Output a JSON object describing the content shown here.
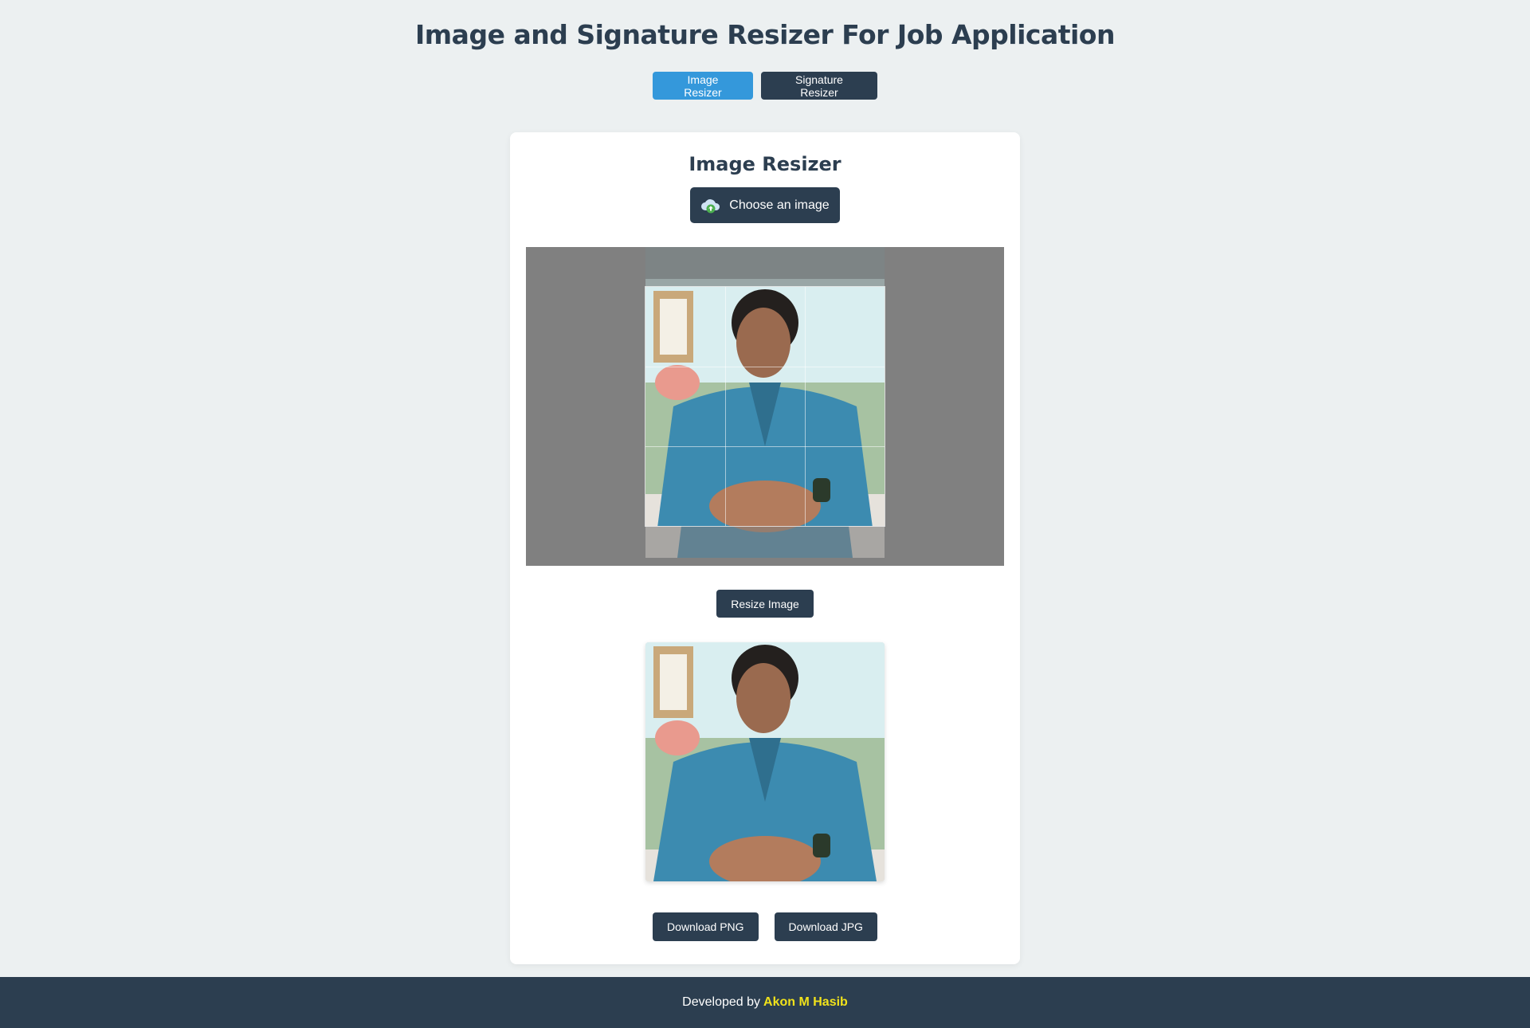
{
  "app": {
    "title": "Image and Signature Resizer For Job Application"
  },
  "tabs": [
    {
      "label": "Image Resizer",
      "active": true
    },
    {
      "label": "Signature Resizer",
      "active": false
    }
  ],
  "card": {
    "title": "Image Resizer",
    "choose_label": "Choose an image",
    "resize_label": "Resize Image",
    "download_png_label": "Download PNG",
    "download_jpg_label": "Download JPG"
  },
  "footer": {
    "prefix": "Developed by",
    "author": "Akon M Hasib"
  },
  "colors": {
    "primary": "#2c3e50",
    "accent": "#3498db",
    "background": "#ecf0f1",
    "author": "#f1e21b"
  },
  "icons": {
    "upload": "cloud-upload-icon"
  }
}
